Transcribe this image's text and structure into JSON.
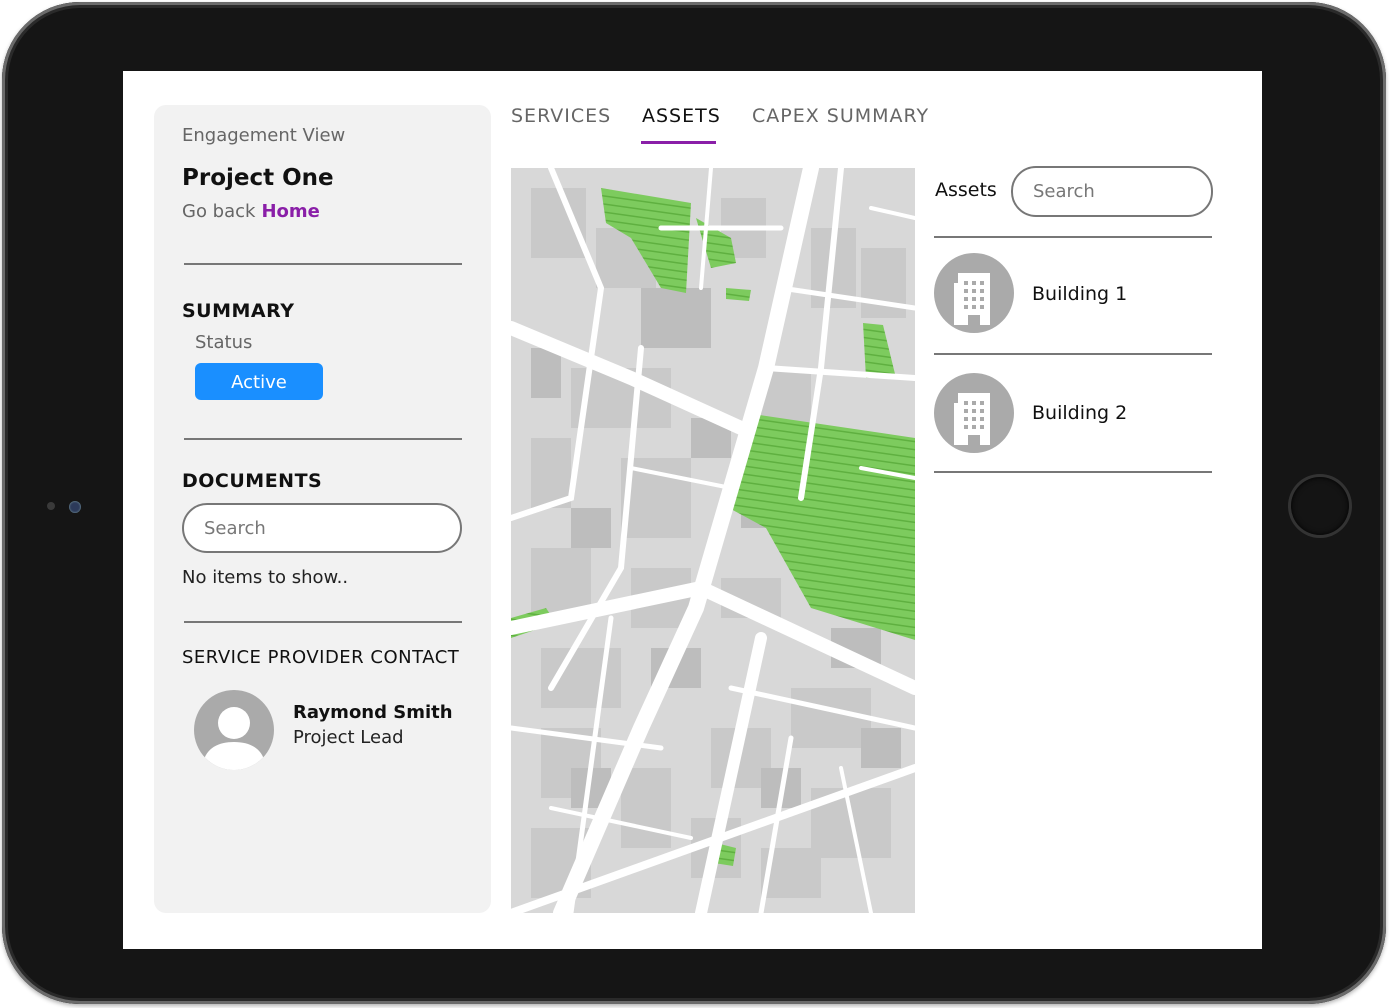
{
  "sidebar": {
    "view_label": "Engagement View",
    "project_title": "Project One",
    "go_back_text": "Go back",
    "home_link": "Home",
    "summary_title": "SUMMARY",
    "status_label": "Status",
    "status_value": "Active",
    "documents_title": "DOCUMENTS",
    "documents_search_placeholder": "Search",
    "documents_empty": "No items to show..",
    "contact_title": "SERVICE PROVIDER CONTACT",
    "contact_name": "Raymond Smith",
    "contact_role": "Project Lead"
  },
  "tabs": [
    {
      "label": "SERVICES",
      "active": false
    },
    {
      "label": "ASSETS",
      "active": true
    },
    {
      "label": "CAPEX SUMMARY",
      "active": false
    }
  ],
  "assets": {
    "label": "Assets",
    "search_placeholder": "Search",
    "items": [
      {
        "name": "Building 1",
        "icon": "building-icon"
      },
      {
        "name": "Building 2",
        "icon": "building-icon"
      }
    ]
  },
  "colors": {
    "accent": "#8a1fa8",
    "status_active": "#1a8fff",
    "park_green": "#7dcb5e",
    "map_base": "#d6d6d6"
  }
}
